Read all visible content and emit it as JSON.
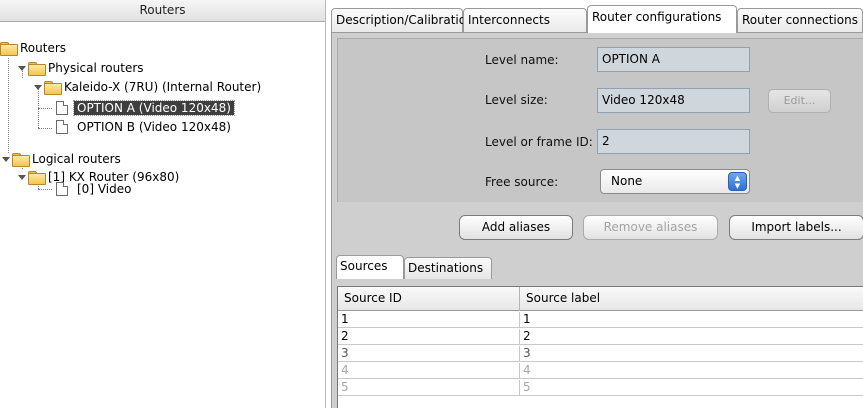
{
  "tree": {
    "header": "Routers",
    "root": "Routers",
    "physical": "Physical routers",
    "kaleido": "Kaleido-X (7RU) (Internal Router)",
    "optionA": "OPTION A (Video 120x48)",
    "optionB": "OPTION B (Video 120x48)",
    "logical": "Logical routers",
    "kx": "[1] KX Router (96x80)",
    "video": "[0] Video"
  },
  "tabs": [
    "Description/Calibrations",
    "Interconnects",
    "Router configurations",
    "Router connections"
  ],
  "level": {
    "name_label": "Level name:",
    "name_value": "OPTION A",
    "size_label": "Level size:",
    "size_value": "Video 120x48",
    "edit_label": "Edit...",
    "frame_label": "Level or frame ID:",
    "frame_value": "2",
    "free_label": "Free source:",
    "free_value": "None"
  },
  "actions": {
    "add": "Add aliases",
    "remove": "Remove aliases",
    "import": "Import labels..."
  },
  "subtabs": [
    "Sources",
    "Destinations"
  ],
  "grid": {
    "columns": [
      "Source ID",
      "Source label"
    ],
    "rows": [
      [
        "1",
        "1"
      ],
      [
        "2",
        "2"
      ],
      [
        "3",
        "3"
      ],
      [
        "4",
        "4"
      ],
      [
        "5",
        "5"
      ]
    ]
  }
}
